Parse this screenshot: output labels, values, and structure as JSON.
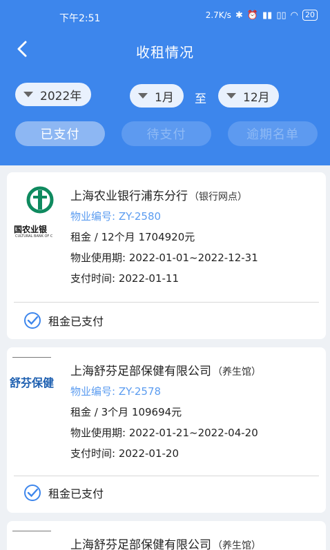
{
  "status_bar": {
    "time": "下午2:51",
    "speed": "2.7K/s",
    "battery": "20"
  },
  "nav": {
    "title": "收租情况"
  },
  "filters": {
    "year": "2022年",
    "month_from": "1月",
    "to_label": "至",
    "month_to": "12月"
  },
  "tabs": [
    {
      "label": "已支付",
      "active": true
    },
    {
      "label": "待支付",
      "active": false
    },
    {
      "label": "逾期名单",
      "active": false
    }
  ],
  "records": [
    {
      "logo_text": "国农业银",
      "logo_sub": "CULTURAL BANK OF C",
      "name": "上海农业银行浦东分行",
      "tag": "（银行网点）",
      "property_id": "物业编号: ZY-2580",
      "rent": "租金 / 12个月 1704920元",
      "period": "物业使用期: 2022-01-01~2022-12-31",
      "paid_time": "支付时间: 2022-01-11",
      "status": "租金已支付"
    },
    {
      "logo_text": "舒芬保健",
      "name": "上海舒芬足部保健有限公司",
      "tag": "（养生馆）",
      "property_id": "物业编号: ZY-2578",
      "rent": "租金 / 3个月 109694元",
      "period": "物业使用期: 2022-01-21~2022-04-20",
      "paid_time": "支付时间: 2022-01-20",
      "status": "租金已支付"
    },
    {
      "name": "上海舒芬足部保健有限公司",
      "tag": "（养生馆）"
    }
  ],
  "colors": {
    "header": "#3d86ec",
    "accent": "#5b9cf0",
    "bank_green": "#0f8a5f"
  }
}
